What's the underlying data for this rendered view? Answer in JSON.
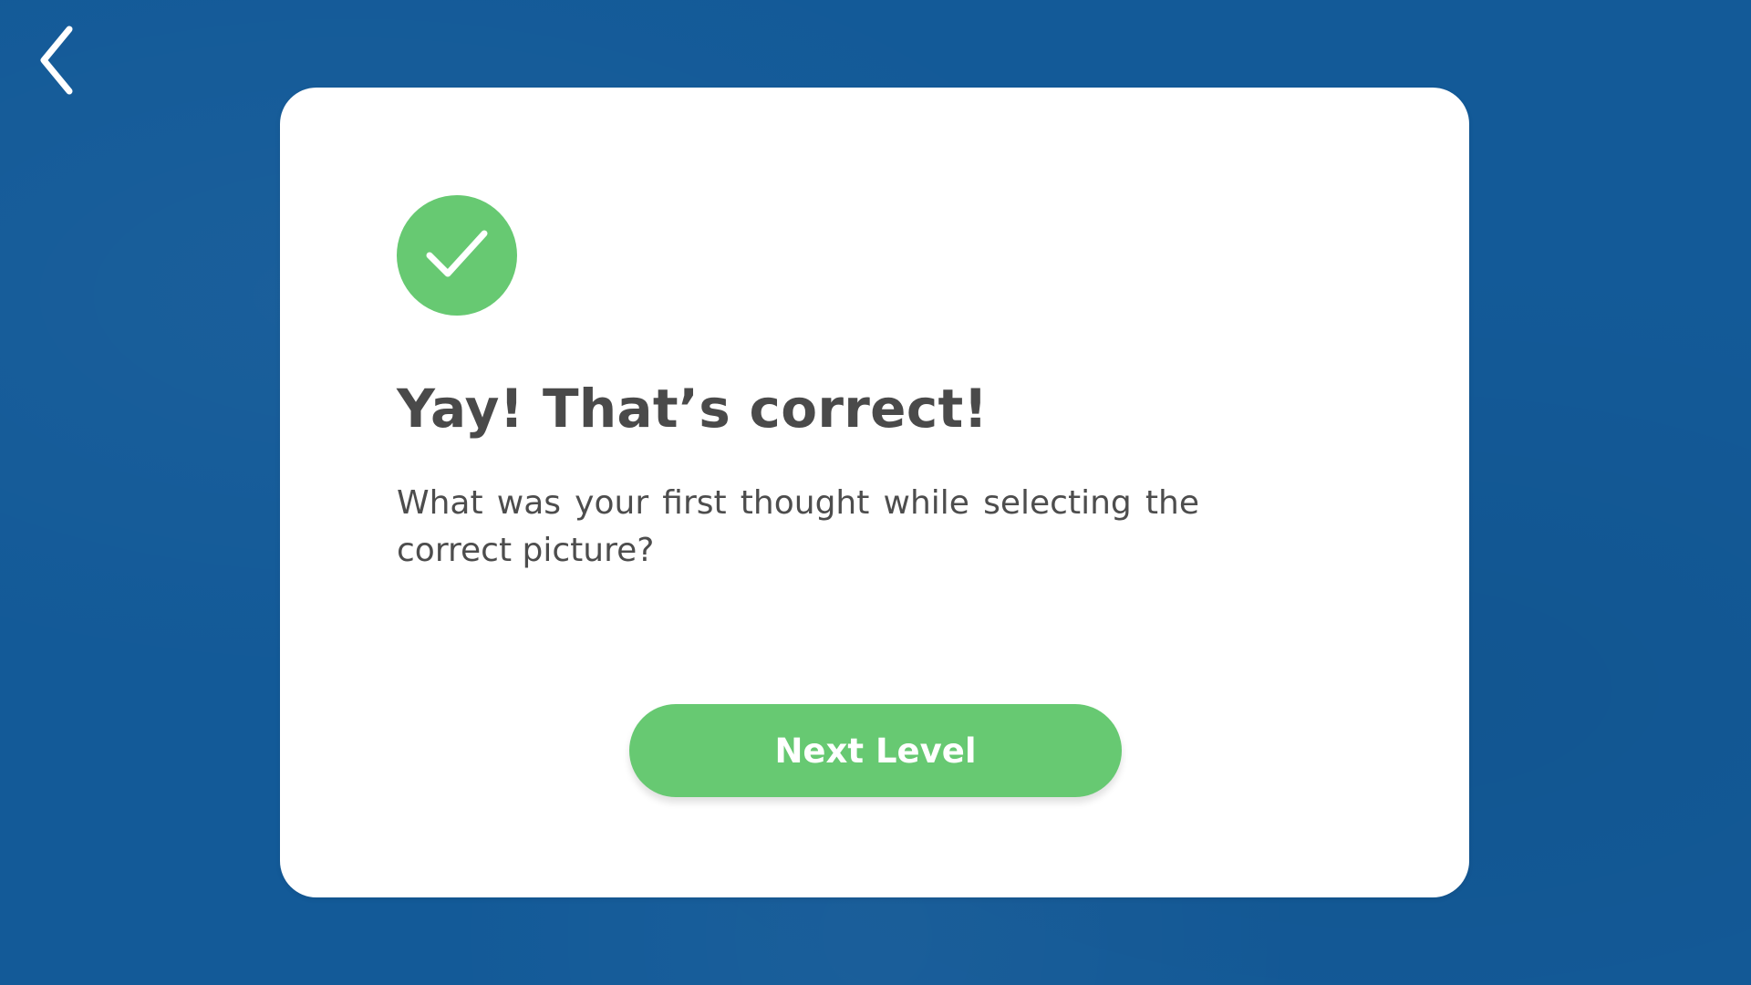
{
  "nav": {
    "back_icon": "chevron-left-icon"
  },
  "result_card": {
    "status_icon": "checkmark-icon",
    "status_color": "#67c972",
    "title": "Yay! That’s correct!",
    "question": "What was your first thought while selecting the correct picture?",
    "next_button_label": "Next Level"
  },
  "colors": {
    "background": "#135a98",
    "card": "#ffffff",
    "accent": "#67c972",
    "text": "#4a4a4a"
  }
}
